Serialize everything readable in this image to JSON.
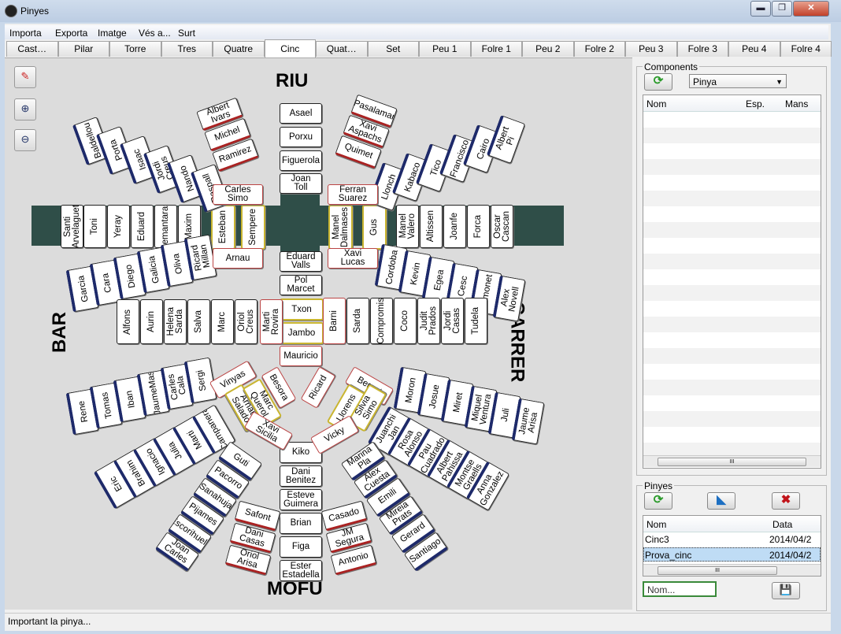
{
  "window": {
    "title": "Pinyes",
    "minimize": "▬",
    "maximize": "❐",
    "close": "✕"
  },
  "menu": [
    "Importa",
    "Exporta",
    "Imatge",
    "Vés a...",
    "Surt"
  ],
  "tabs": [
    "Cast…",
    "Pilar",
    "Torre",
    "Tres",
    "Quatre",
    "Cinc",
    "Quat…",
    "Set",
    "Peu 1",
    "Folre 1",
    "Peu 2",
    "Folre 2",
    "Peu 3",
    "Folre 3",
    "Peu 4",
    "Folre 4"
  ],
  "active_tab": "Cinc",
  "tools": {
    "eraser": "✎",
    "zoom_in": "⊕",
    "zoom_out": "⊖"
  },
  "labels": {
    "top": "RIU",
    "bottom": "MOFU",
    "left": "BAR",
    "right": "CARRER"
  },
  "pinya": {
    "center_column": [
      "Asael",
      "Porxu",
      "Figuerola",
      "Joan\nToll",
      "Eduard\nValls",
      "Pol\nMarcet",
      "Txon",
      "Jambo",
      "Mauricio"
    ],
    "bottom_column": [
      "Kiko",
      "Dani\nBenitez",
      "Esteve\nGuimera",
      "Brian",
      "Figa",
      "Ester\nEstadella"
    ],
    "left_band": [
      "Santi\nArvelaguet",
      "Toni",
      "Yeray",
      "Eduard",
      "Demantaras",
      "Maxim",
      "Esteban",
      "Sempere"
    ],
    "right_band": [
      "Manel\nDalmases",
      "Gus",
      "Manel\nValero",
      "Altissen",
      "Joanfe",
      "Forca",
      "Oscar\nCascan"
    ],
    "top_left_arm": [
      "Baldellou",
      "Porta",
      "Isaac",
      "Jordi\nCreus",
      "Nando",
      "Raspall"
    ],
    "top_left_mini": [
      "Albert\nIvars",
      "Michel",
      "Ramirez"
    ],
    "top_right_arm": [
      "Llonch",
      "Kabaco",
      "Tico",
      "Francisco",
      "Cairo",
      "Albert\nPi"
    ],
    "top_right_mini": [
      "Pasalamar",
      "Xavi\nAspachs",
      "Quimet"
    ],
    "left_middle_arm": [
      "Garcia",
      "Cara",
      "Diego",
      "Galicia",
      "Oliva",
      "Ricard\nMillan"
    ],
    "right_middle_arm": [
      "Cordoba",
      "Kevin",
      "Egea",
      "Cesc",
      "Ramonet",
      "Alex\nNovell"
    ],
    "left_row": [
      "Alfons",
      "Aurin",
      "Helena\nSarda",
      "Salva",
      "Marc",
      "Oriol\nCreus",
      "Marti\nRovira"
    ],
    "right_row": [
      "Barni",
      "Sarda",
      "Compromis",
      "Coco",
      "Judit\nPrados",
      "Jordi\nCasas",
      "Tudela"
    ],
    "bottom_left_arm": [
      "Rene",
      "Tomas",
      "Iban",
      "JaumeMas",
      "Carles\nCala",
      "Sergi"
    ],
    "bottom_right_arm": [
      "Moron",
      "Josue",
      "Miret",
      "Miquel\nVentura",
      "Juli",
      "Jaume\nArisa"
    ],
    "bottom_left_diag": [
      "Eric",
      "Brahim",
      "Ignacio",
      "Julia",
      "Marti",
      "Campanera"
    ],
    "bottom_right_diag": [
      "Juanchi\nJan",
      "Rosa\nAlonso",
      "Pau\nCuadrado",
      "Albert\nPahissa",
      "Montse\nGraells",
      "Anna\nGonzalez"
    ],
    "lower_left_arm": [
      "Guti",
      "Pacorro",
      "Sanahuja",
      "Pijames",
      "Escorihuela",
      "Joan\nCarles"
    ],
    "lower_right_arm": [
      "Marina\nPla",
      "Alex\nCuesta",
      "Emili",
      "Mireia\nPrats",
      "Gerard",
      "Santiago"
    ],
    "lower_left_mini": [
      "Safont",
      "Dani\nCasas",
      "Oriol\nArisa"
    ],
    "lower_right_mini": [
      "Casado",
      "JM\nSegura",
      "Antonio"
    ],
    "center_sides": [
      "Carles\nSimo",
      "Arnau",
      "Ferran\nSuarez",
      "Xavi\nLucas"
    ],
    "center_star": [
      "Vinyas",
      "Besora",
      "Arnau\nSalado",
      "Marc\nQuerol",
      "Xavi\nSicilia",
      "Ricard",
      "Bernat",
      "Llorens",
      "Silvia\nSimo",
      "Vicky"
    ]
  },
  "components_panel": {
    "title": "Components",
    "select_value": "Pinya",
    "columns": [
      "Nom",
      "Esp.",
      "Mans"
    ],
    "refresh_icon": "⟳"
  },
  "pinyes_panel": {
    "title": "Pinyes",
    "columns": [
      "Nom",
      "Data"
    ],
    "rows": [
      {
        "nom": "Cinc3",
        "data": "2014/04/2"
      },
      {
        "nom": "Prova_cinc",
        "data": "2014/04/2"
      }
    ],
    "refresh_icon": "⟳",
    "edit_icon": "◣",
    "delete_icon": "✖",
    "save_icon": "💾",
    "name_placeholder": "Nom..."
  },
  "scroll_grip": "III",
  "status": "Important la pinya..."
}
